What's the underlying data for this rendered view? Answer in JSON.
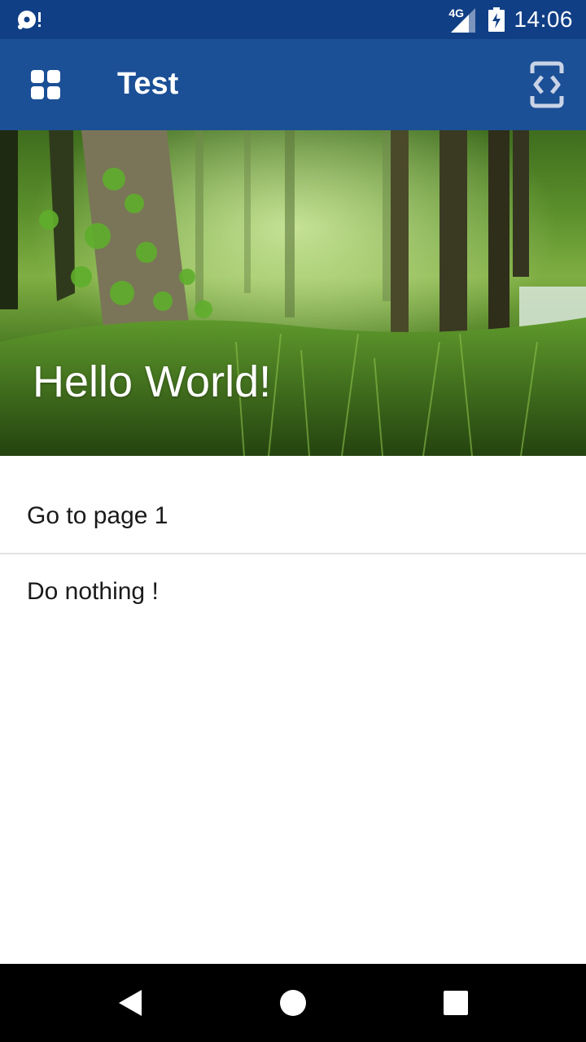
{
  "status_bar": {
    "network_type": "4G",
    "time": "14:06",
    "left_icon": "disc-alert-icon",
    "signal_icon": "signal-icon",
    "battery_icon": "battery-charging-icon"
  },
  "app_bar": {
    "title": "Test",
    "left_icon": "grid-apps-icon",
    "right_icon": "code-view-icon",
    "background": "#1b4f96"
  },
  "hero": {
    "title": "Hello World!"
  },
  "list": {
    "items": [
      {
        "label": "Go to page 1"
      },
      {
        "label": "Do nothing !"
      }
    ]
  },
  "nav_bar": {
    "back_icon": "back-triangle-icon",
    "home_icon": "home-circle-icon",
    "recents_icon": "recents-square-icon"
  },
  "colors": {
    "status_bar": "#113f86",
    "app_bar": "#1b4f96",
    "nav_bar": "#000000",
    "text_primary": "#1a1a1a"
  }
}
